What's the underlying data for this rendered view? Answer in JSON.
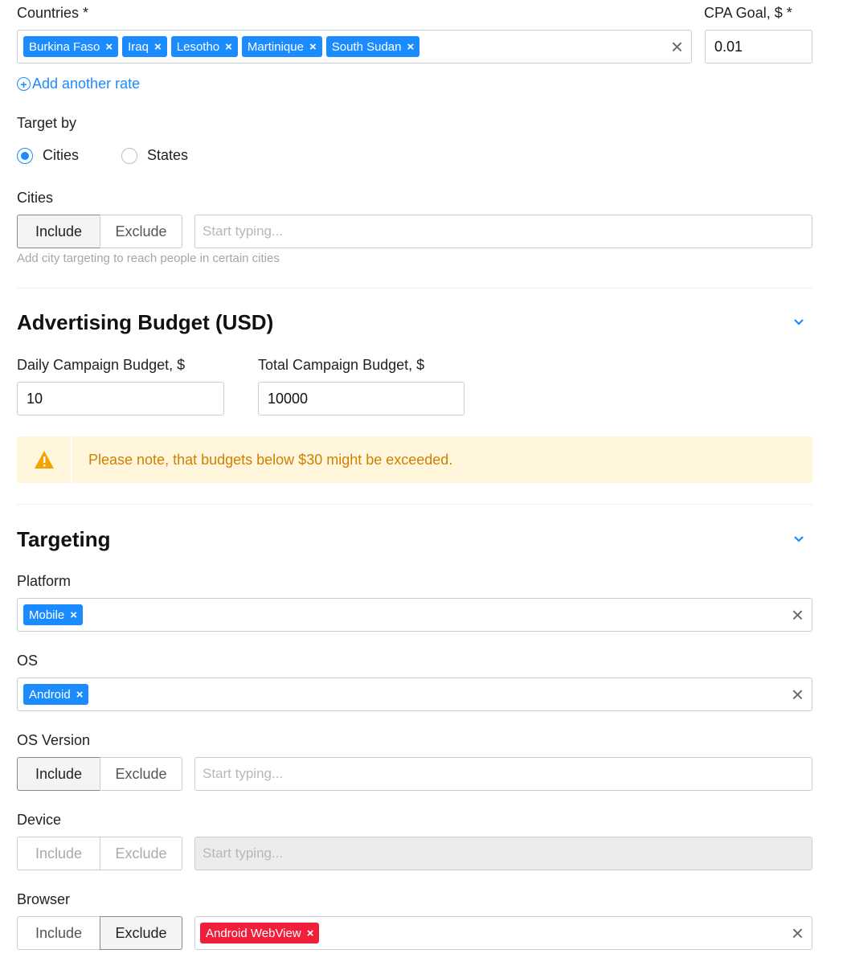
{
  "countries": {
    "label": "Countries *",
    "tags": [
      "Burkina Faso",
      "Iraq",
      "Lesotho",
      "Martinique",
      "South Sudan"
    ]
  },
  "cpa": {
    "label": "CPA Goal, $ *",
    "value": "0.01"
  },
  "add_rate": "Add another rate",
  "target_by": {
    "label": "Target by",
    "options": [
      "Cities",
      "States"
    ],
    "selected": "Cities"
  },
  "cities": {
    "label": "Cities",
    "include": "Include",
    "exclude": "Exclude",
    "placeholder": "Start typing...",
    "hint": "Add city targeting to reach people in certain cities"
  },
  "budget": {
    "title": "Advertising Budget (USD)",
    "daily_label": "Daily Campaign Budget, $",
    "daily_value": "10",
    "total_label": "Total Campaign Budget, $",
    "total_value": "10000",
    "warning": "Please note, that budgets below $30 might be exceeded."
  },
  "targeting": {
    "title": "Targeting",
    "platform": {
      "label": "Platform",
      "tags": [
        "Mobile"
      ]
    },
    "os": {
      "label": "OS",
      "tags": [
        "Android"
      ]
    },
    "os_version": {
      "label": "OS Version",
      "include": "Include",
      "exclude": "Exclude",
      "placeholder": "Start typing..."
    },
    "device": {
      "label": "Device",
      "include": "Include",
      "exclude": "Exclude",
      "placeholder": "Start typing..."
    },
    "browser": {
      "label": "Browser",
      "include": "Include",
      "exclude": "Exclude",
      "tags": [
        "Android WebView"
      ]
    }
  },
  "colors": {
    "accent": "#1a8cff",
    "danger": "#f0203a",
    "warning_bg": "#fff6dc",
    "warning_text": "#d08000"
  }
}
